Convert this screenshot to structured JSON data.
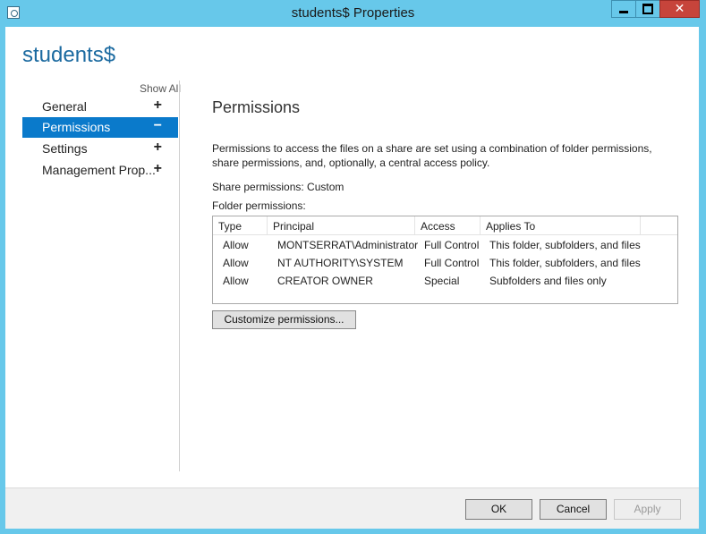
{
  "window": {
    "title": "students$ Properties",
    "close_glyph": "✕"
  },
  "share_name": "students$",
  "nav": {
    "show_all": "Show All",
    "items": [
      {
        "label": "General",
        "sign": "+"
      },
      {
        "label": "Permissions",
        "sign": "−",
        "selected": true
      },
      {
        "label": "Settings",
        "sign": "+"
      },
      {
        "label": "Management Prop...",
        "sign": "+"
      }
    ]
  },
  "permissions": {
    "title": "Permissions",
    "description": "Permissions to access the files on a share are set using a combination of folder permissions, share permissions, and, optionally, a central access policy.",
    "share_permissions": "Share permissions:  Custom",
    "folder_permissions_label": "Folder permissions:",
    "columns": [
      "Type",
      "Principal",
      "Access",
      "Applies To"
    ],
    "rows": [
      {
        "type": "Allow",
        "principal": "MONTSERRAT\\Administrator",
        "access": "Full Control",
        "applies_to": "This folder, subfolders, and files"
      },
      {
        "type": "Allow",
        "principal": "NT AUTHORITY\\SYSTEM",
        "access": "Full Control",
        "applies_to": "This folder, subfolders, and files"
      },
      {
        "type": "Allow",
        "principal": "CREATOR OWNER",
        "access": "Special",
        "applies_to": "Subfolders and files only"
      }
    ],
    "customize_button": "Customize permissions..."
  },
  "footer": {
    "ok": "OK",
    "cancel": "Cancel",
    "apply": "Apply"
  },
  "colors": {
    "title_bar": "#67c8ea",
    "selected_nav": "#0a7acb",
    "share_name": "#1b6aa0",
    "close_button": "#c7443b"
  },
  "icons": {
    "app": "properties-app-icon",
    "minimize": "minimize-icon",
    "maximize": "maximize-icon",
    "close": "close-icon"
  }
}
